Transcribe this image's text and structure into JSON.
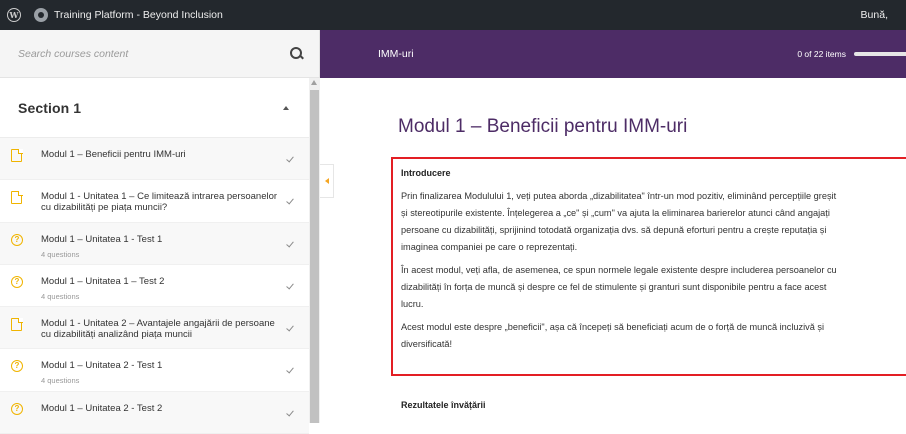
{
  "admin_bar": {
    "site_title": "Training Platform - Beyond Inclusion",
    "greeting": "Bună,"
  },
  "sidebar": {
    "search_placeholder": "Search courses content",
    "section_title": "Section 1",
    "items": [
      {
        "type": "lesson",
        "title": "Modul 1 – Beneficii pentru IMM-uri",
        "sub": ""
      },
      {
        "type": "lesson",
        "title": "Modul 1 - Unitatea 1 – Ce limitează intrarea persoanelor cu dizabilități pe piața muncii?",
        "sub": ""
      },
      {
        "type": "quiz",
        "title": "Modul 1 – Unitatea 1 - Test 1",
        "sub": "4 questions"
      },
      {
        "type": "quiz",
        "title": "Modul 1 – Unitatea 1 – Test 2",
        "sub": "4 questions"
      },
      {
        "type": "lesson",
        "title": "Modul 1 - Unitatea 2 – Avantajele angajării de persoane cu dizabilități analizând piața muncii",
        "sub": ""
      },
      {
        "type": "quiz",
        "title": "Modul 1 – Unitatea 2 - Test 1",
        "sub": "4 questions"
      },
      {
        "type": "quiz",
        "title": "Modul 1 – Unitatea 2 - Test 2",
        "sub": ""
      }
    ]
  },
  "header": {
    "course_title": "IMM-uri",
    "progress_text": "0 of 22 items",
    "progress_fraction": 0
  },
  "content": {
    "lesson_title": "Modul 1 – Beneficii pentru IMM-uri",
    "intro_heading": "Introducere",
    "paragraph_lines": [
      [
        "Prin finalizarea Modulului 1, veți putea aborda „dizabilitatea\" într-un mod pozitiv, eliminând percepțiile greșit",
        "și stereotipurile existente. Înțelegerea a „ce\" și „cum\" va ajuta la eliminarea barierelor atunci când angajați",
        "persoane cu dizabilități, sprijinind totodată organizația dvs. să depună eforturi pentru a crește reputația și",
        "imaginea companiei pe care o reprezentați."
      ],
      [
        "În acest modul, veți afla, de asemenea, ce spun normele legale existente despre includerea persoanelor cu",
        "dizabilități în forța de muncă și despre ce fel de stimulente și granturi sunt disponibile pentru a face acest",
        "lucru."
      ],
      [
        "Acest modul este despre „beneficii\", așa că începeți să beneficiați acum de o forță de muncă incluzivă și",
        "diversificată!"
      ]
    ],
    "results_heading": "Rezultatele învățării"
  },
  "colors": {
    "brand_purple": "#4d2c66",
    "accent_orange": "#f5a623",
    "icon_yellow": "#f0b400",
    "highlight_red": "#e31e24"
  }
}
